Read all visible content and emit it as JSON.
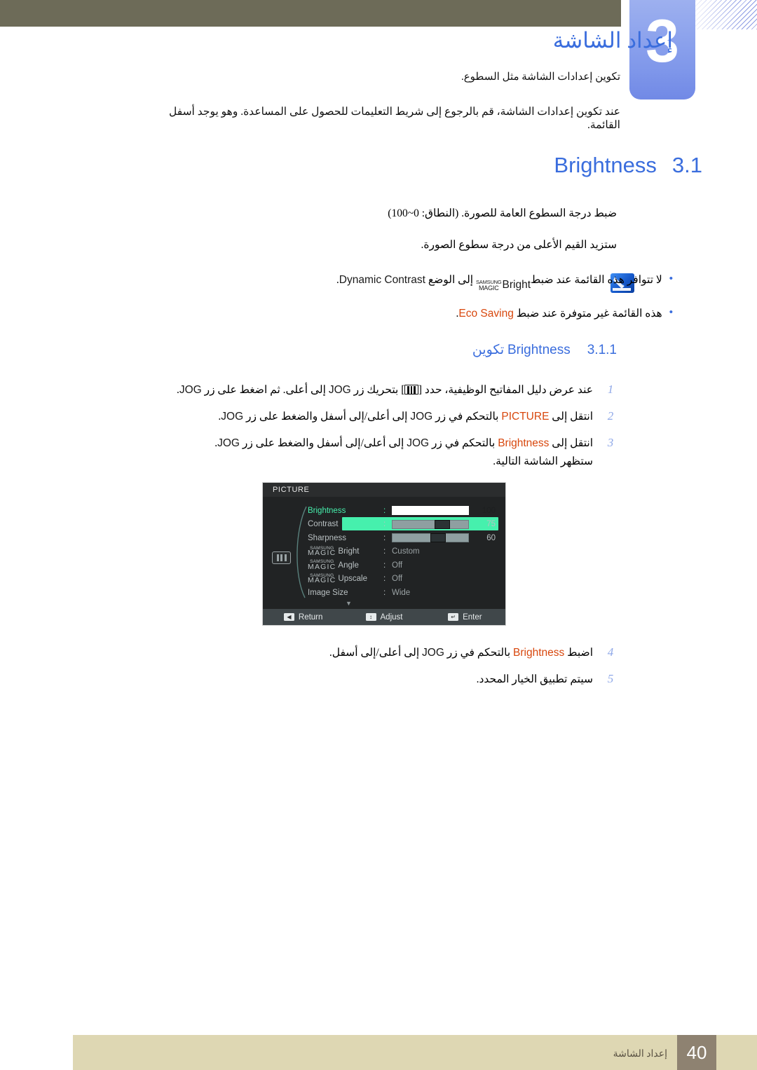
{
  "chapter": {
    "number": "3",
    "title": "إعداد الشاشة",
    "intro_line_1": "تكوين إعدادات الشاشة مثل السطوع.",
    "intro_line_2": "عند تكوين إعدادات الشاشة، قم بالرجوع إلى شريط التعليمات للحصول على المساعدة. وهو يوجد أسفل القائمة."
  },
  "section": {
    "number": "3.1",
    "title": "Brightness",
    "desc_line_1": "ضبط درجة السطوع العامة للصورة. (النطاق: 0~100)",
    "desc_line_2": "ستزيد القيم الأعلى من درجة سطوع الصورة."
  },
  "notes": {
    "icon_name": "note-pencil-icon",
    "items": [
      {
        "before": "لا تتوافر هذه القائمة عند ضبط",
        "magic_top": "SAMSUNG",
        "magic_bottom": "MAGIC",
        "magic_word": "Bright",
        "middle": "إلى الوضع",
        "term": "Dynamic Contrast",
        "after": "."
      },
      {
        "before": "هذه القائمة غير متوفرة عند ضبط",
        "term": "Eco Saving",
        "after": "."
      }
    ]
  },
  "subsection": {
    "number": "3.1.1",
    "title_ar": "تكوين",
    "title_en": "Brightness"
  },
  "steps_before": [
    {
      "index": "1",
      "p1": "عند عرض دليل المفاتيح الوظيفية، حدد [",
      "glyph": "menu-bars-glyph",
      "p2": "] بتحريك زر",
      "jog": "JOG",
      "p3": "إلى أعلى. ثم اضغط على زر",
      "jog2": "JOG",
      "p4": "."
    },
    {
      "index": "2",
      "p1": "انتقل إلى",
      "term": "PICTURE",
      "p2": "بالتحكم في زر",
      "jog": "JOG",
      "p3": "إلى أعلى/إلى أسفل والضغط على زر",
      "jog2": "JOG",
      "p4": "."
    },
    {
      "index": "3",
      "p1": "انتقل إلى",
      "term": "Brightness",
      "p2": "بالتحكم في زر",
      "jog": "JOG",
      "p3": "إلى أعلى/إلى أسفل والضغط على زر",
      "jog2": "JOG",
      "p4": ".",
      "sub": "ستظهر الشاشة التالية."
    }
  ],
  "steps_after": [
    {
      "index": "4",
      "p1": "اضبط",
      "term": "Brightness",
      "p2": "بالتحكم في زر",
      "jog": "JOG",
      "p3": "إلى أعلى/إلى أسفل",
      "p4": "."
    },
    {
      "index": "5",
      "p1": "سيتم تطبيق الخيار المحدد."
    }
  ],
  "osd": {
    "title": "PICTURE",
    "left_icon_name": "picture-menu-icon",
    "rows": [
      {
        "label": "Brightness",
        "type": "slider",
        "value": "100",
        "percent": 100,
        "active": true
      },
      {
        "label": "Contrast",
        "type": "slider",
        "value": "75",
        "percent": 75,
        "active": false
      },
      {
        "label": "Sharpness",
        "type": "slider",
        "value": "60",
        "percent": 60,
        "active": false
      },
      {
        "label": "Bright",
        "type": "magic",
        "magic_top": "SAMSUNG",
        "magic_bottom": "MAGIC",
        "value": "Custom",
        "active": false
      },
      {
        "label": "Angle",
        "type": "magic",
        "magic_top": "SAMSUNG",
        "magic_bottom": "MAGIC",
        "value": "Off",
        "active": false
      },
      {
        "label": "Upscale",
        "type": "magic",
        "magic_top": "SAMSUNG",
        "magic_bottom": "MAGIC",
        "value": "Off",
        "active": false
      },
      {
        "label": "Image Size",
        "type": "text",
        "value": "Wide",
        "active": false
      }
    ],
    "more_indicator": "▼",
    "footer": [
      {
        "key": "◀",
        "label": "Return"
      },
      {
        "key": "↕",
        "label": "Adjust"
      },
      {
        "key": "↵",
        "label": "Enter"
      }
    ]
  },
  "footer": {
    "page_number": "40",
    "label": "إعداد الشاشة"
  }
}
